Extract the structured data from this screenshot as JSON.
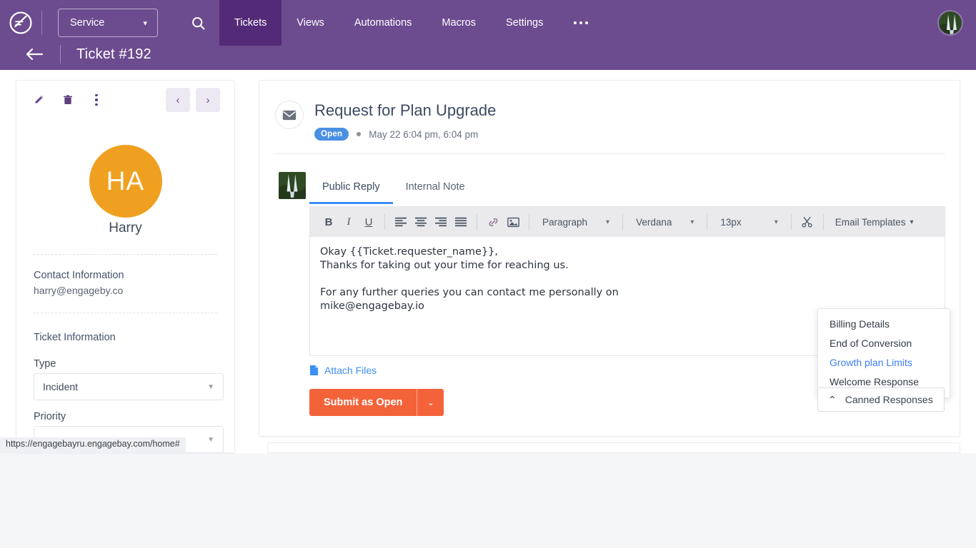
{
  "topnav": {
    "logo_name": "engagebay-logo",
    "product_select": {
      "label": "Service",
      "caret": "▾"
    },
    "search_icon": "search-icon",
    "items": [
      {
        "label": "Tickets",
        "active": true
      },
      {
        "label": "Views",
        "active": false
      },
      {
        "label": "Automations",
        "active": false
      },
      {
        "label": "Macros",
        "active": false
      },
      {
        "label": "Settings",
        "active": false
      }
    ],
    "overflow_label": "•••",
    "avatar_name": "user-avatar"
  },
  "breadcrumb": {
    "back_icon": "back-arrow-icon",
    "title": "Ticket #192"
  },
  "contact_panel": {
    "tools": [
      "edit-icon",
      "delete-icon",
      "more-options-icon"
    ],
    "prev_label": "‹",
    "next_label": "›",
    "avatar_initials": "HA",
    "name": "Harry",
    "contact_heading": "Contact Information",
    "contact_email": "harry@engageby.co",
    "ticket_heading": "Ticket Information",
    "type_label": "Type",
    "type_value": "Incident",
    "priority_label": "Priority",
    "priority_value": "",
    "select_arrow": "▼"
  },
  "ticket": {
    "channel_icon": "email-icon",
    "title": "Request for Plan Upgrade",
    "status_badge": "Open",
    "date": "May 22 6:04 pm, 6:04 pm"
  },
  "editor": {
    "avatar_name": "agent-avatar",
    "tabs": [
      {
        "label": "Public Reply",
        "active": true
      },
      {
        "label": "Internal Note",
        "active": false
      }
    ],
    "toolbar": {
      "bold": "B",
      "italic": "I",
      "underline": "U",
      "align_left": "align-left-icon",
      "align_center": "align-center-icon",
      "align_right": "align-right-icon",
      "align_justify": "align-justify-icon",
      "link": "link-icon",
      "image": "image-icon",
      "block_format": "Paragraph",
      "font_family": "Verdana",
      "font_size": "13px",
      "snippet": "scissors-icon",
      "email_templates": "Email Templates",
      "caret": "▾"
    },
    "body": "Okay {{Ticket.requester_name}},\nThanks for taking out your time for reaching us.\n\nFor any further queries you can contact me personally on\nmike@engagebay.io",
    "attach_label": "Attach Files",
    "attach_icon": "file-icon",
    "submit_label": "Submit as Open",
    "submit_caret": "⌄"
  },
  "canned_responses": {
    "button_label": "Canned Responses",
    "chevron": "⌃",
    "items": [
      {
        "label": "Billing Details",
        "highlighted": false
      },
      {
        "label": "End of Conversion",
        "highlighted": false
      },
      {
        "label": "Growth plan Limits",
        "highlighted": true
      },
      {
        "label": "Welcome Response",
        "highlighted": false
      }
    ]
  },
  "statusbar": {
    "url": "https://engagebayru.engagebay.com/home#"
  },
  "colors": {
    "brand_purple": "#6d4b8f",
    "active_purple": "#532a77",
    "avatar_orange": "#f0a020",
    "badge_blue": "#4a90e2",
    "submit_orange": "#f4623a",
    "link_blue": "#3e8ef7"
  }
}
